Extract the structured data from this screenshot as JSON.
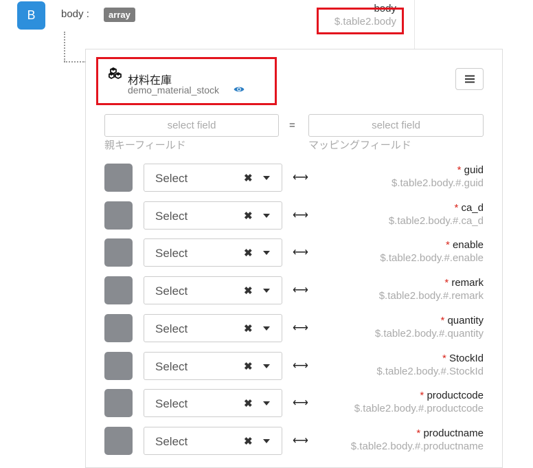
{
  "header": {
    "badge": "B",
    "label": "body :",
    "type": "array",
    "name": "body",
    "path": "$.table2.body"
  },
  "table": {
    "title": "材料在庫",
    "subtitle": "demo_material_stock",
    "icon": "cubes-icon"
  },
  "mapping": {
    "parent_placeholder": "select field",
    "equals": "=",
    "mapping_placeholder": "select field",
    "parent_hint": "親キーフィールド",
    "mapping_hint": "マッピングフィールド"
  },
  "rows": [
    {
      "select": "Select",
      "required": "*",
      "name": "guid",
      "path": "$.table2.body.#.guid"
    },
    {
      "select": "Select",
      "required": "*",
      "name": "ca_d",
      "path": "$.table2.body.#.ca_d"
    },
    {
      "select": "Select",
      "required": "*",
      "name": "enable",
      "path": "$.table2.body.#.enable"
    },
    {
      "select": "Select",
      "required": "*",
      "name": "remark",
      "path": "$.table2.body.#.remark"
    },
    {
      "select": "Select",
      "required": "*",
      "name": "quantity",
      "path": "$.table2.body.#.quantity"
    },
    {
      "select": "Select",
      "required": "*",
      "name": "StockId",
      "path": "$.table2.body.#.StockId"
    },
    {
      "select": "Select",
      "required": "*",
      "name": "productcode",
      "path": "$.table2.body.#.productcode"
    },
    {
      "select": "Select",
      "required": "*",
      "name": "productname",
      "path": "$.table2.body.#.productname"
    }
  ],
  "glyphs": {
    "clear": "✖",
    "arrow": "⟷"
  },
  "colors": {
    "badge": "#2d8fdc",
    "highlight": "#e3141e",
    "required": "#d9261c",
    "square": "#888b90"
  }
}
